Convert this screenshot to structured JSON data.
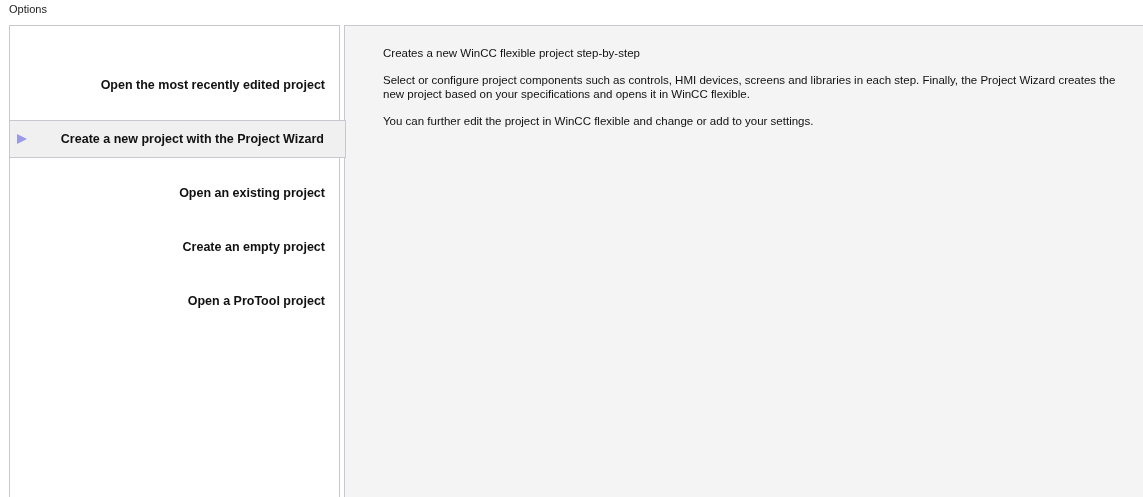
{
  "title": "Options",
  "options": [
    {
      "label": "Open the most recently edited project",
      "selected": false
    },
    {
      "label": "Create a new project with the Project Wizard",
      "selected": true
    },
    {
      "label": "Open an existing project",
      "selected": false
    },
    {
      "label": "Create an empty project",
      "selected": false
    },
    {
      "label": "Open a ProTool project",
      "selected": false
    }
  ],
  "description": [
    "Creates a new WinCC flexible project step-by-step",
    "Select or configure project components such as controls, HMI devices, screens and libraries in each step. Finally, the Project Wizard creates the new project based on your specifications and opens it in WinCC flexible.",
    "You can further edit the project in WinCC flexible and change or add to your settings."
  ]
}
